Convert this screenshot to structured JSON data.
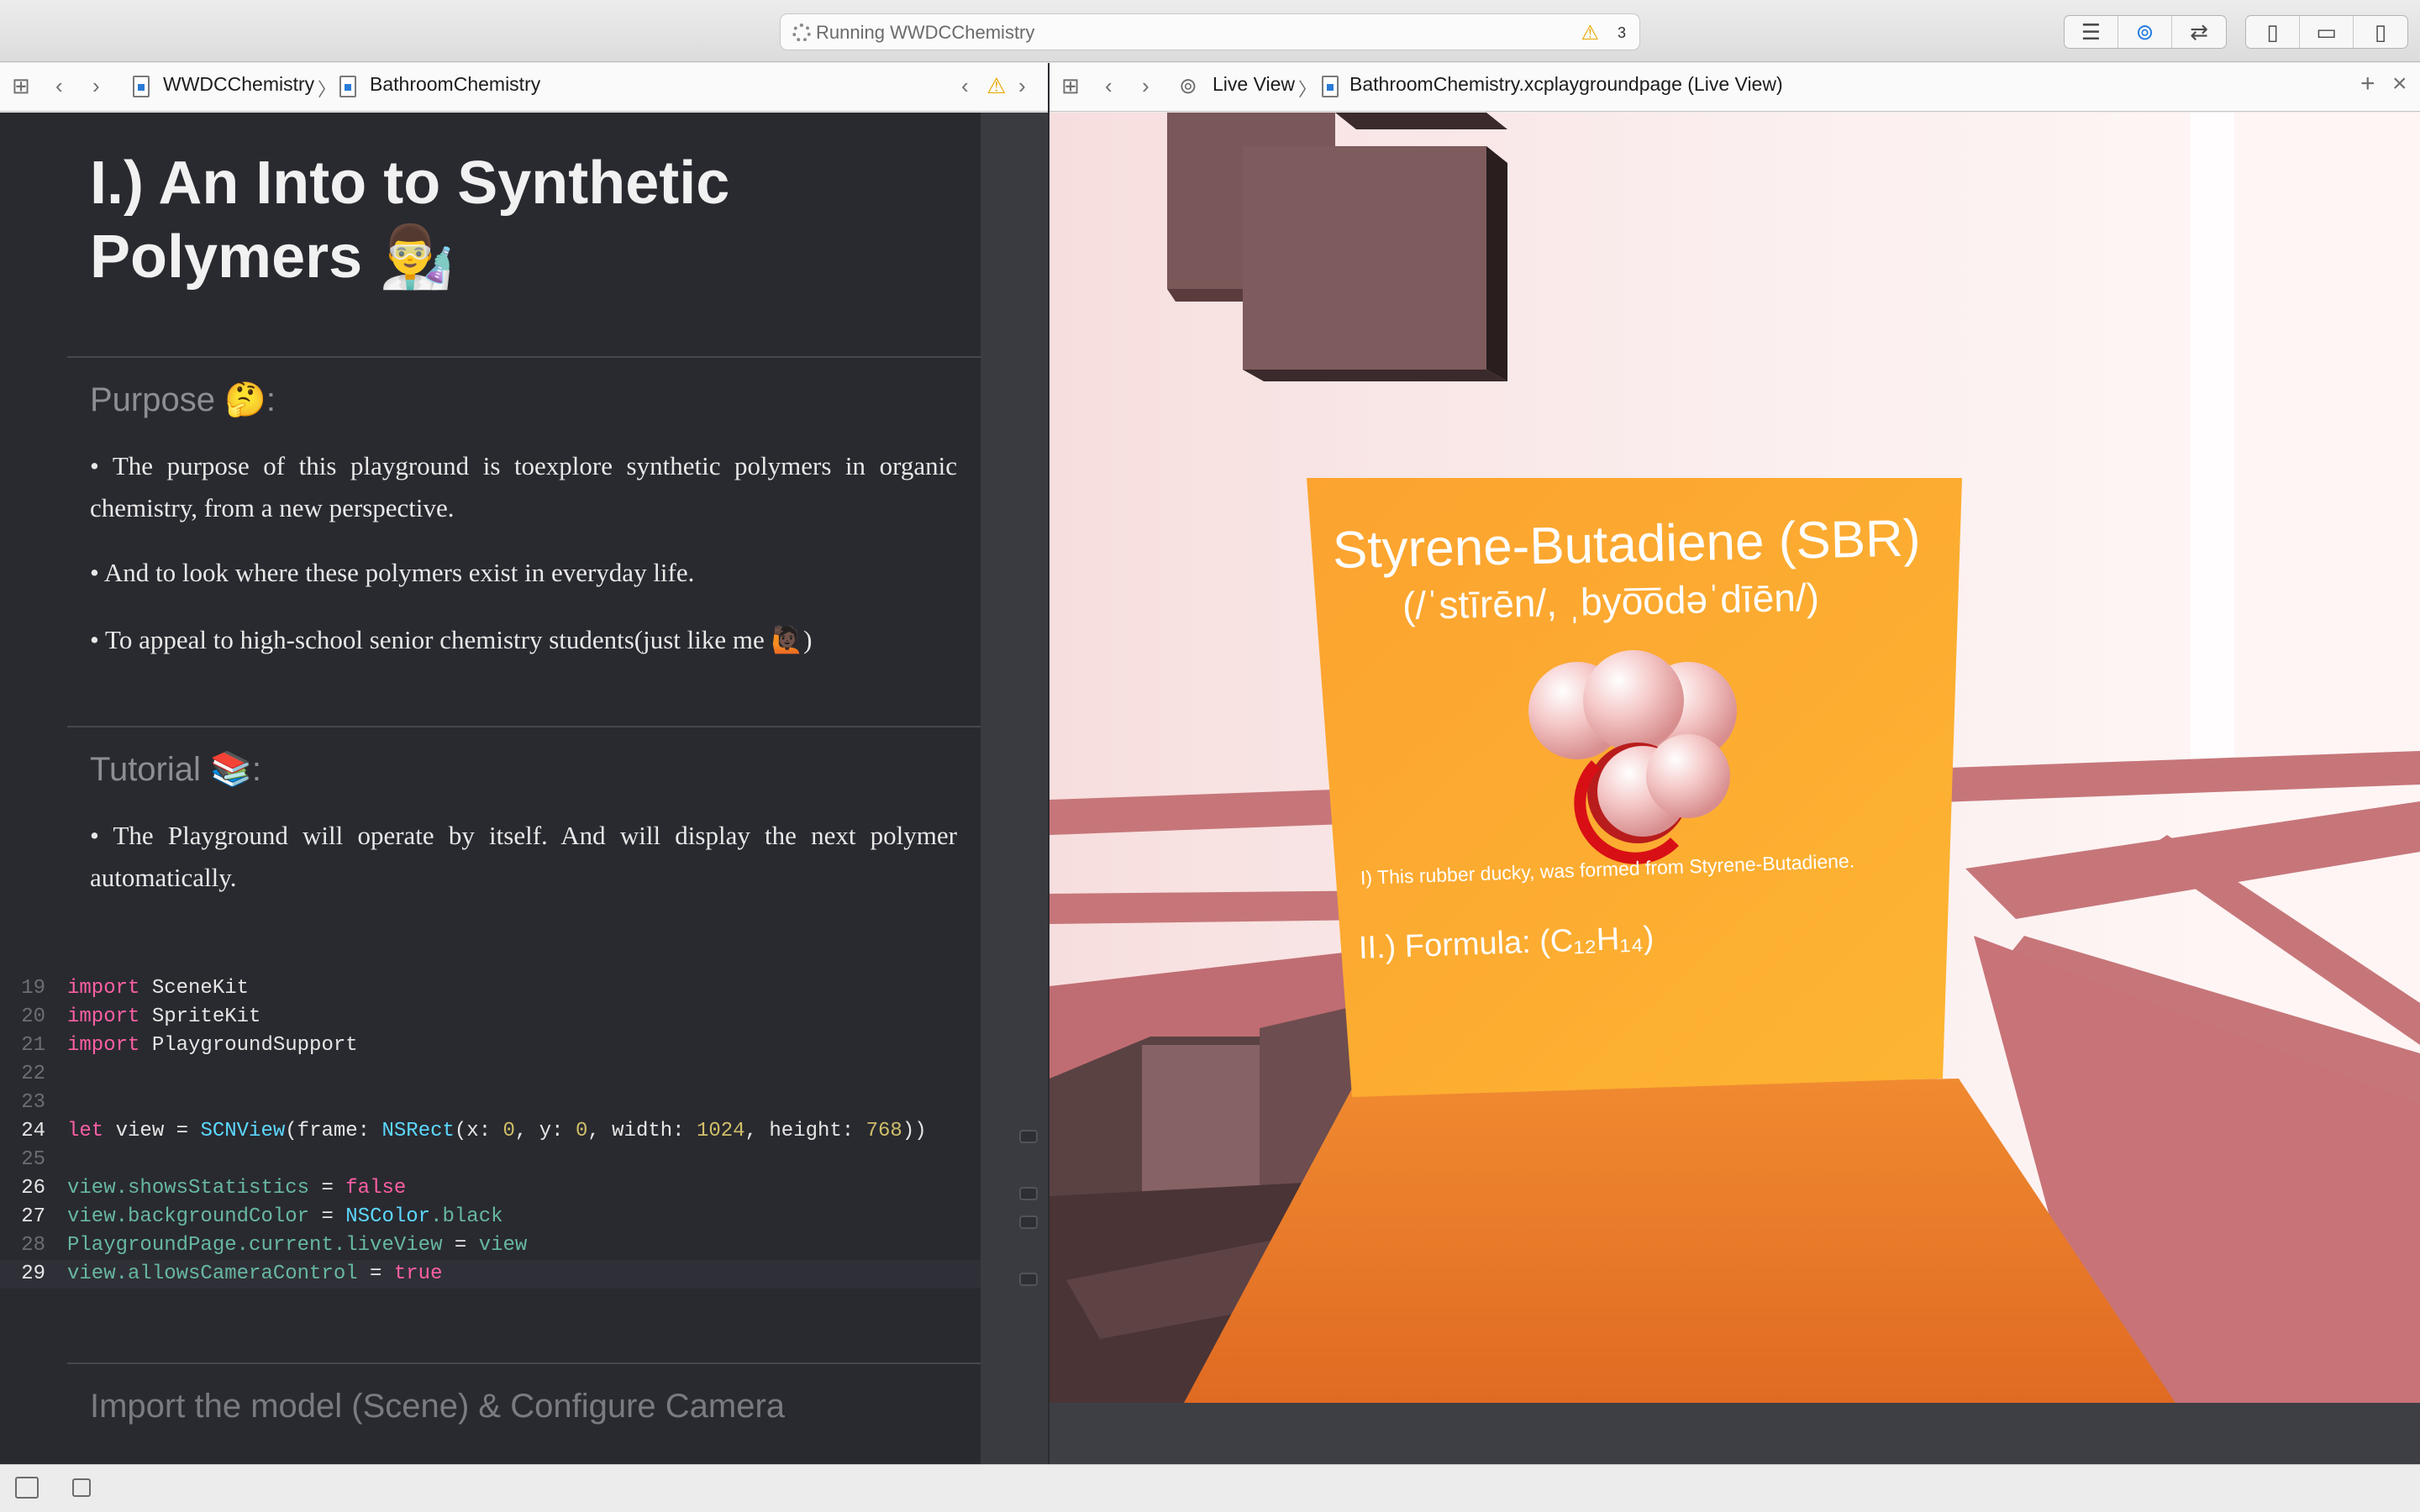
{
  "window": {
    "status": "Running WWDCChemistry",
    "warning_count": "3",
    "icons": [
      "spinner-icon",
      "warning-icon",
      "editor-standard-icon",
      "editor-assistant-icon",
      "editor-version-icon",
      "navigator-toggle-icon",
      "debug-area-toggle-icon",
      "utilities-toggle-icon"
    ]
  },
  "left_pathbar": {
    "project": "WWDCChemistry",
    "page": "BathroomChemistry"
  },
  "right_pathbar": {
    "mode": "Live View",
    "file": "BathroomChemistry.xcplaygroundpage (Live View)"
  },
  "doc": {
    "title": "I.) An Into to Synthetic Polymers 👨‍🔬",
    "purpose_heading": "Purpose 🤔:",
    "purpose_points": [
      "• The purpose of this playground is toexplore synthetic polymers in organic chemistry, from a new perspective.",
      "• And to look where these polymers exist in everyday life.",
      "• To appeal to high-school senior chemistry students(just like me 🙋🏿)"
    ],
    "tutorial_heading": "Tutorial 📚:",
    "tutorial_points": [
      "• The Playground will operate by itself. And will display the next polymer automatically."
    ],
    "next_heading": "Import the model (Scene) & Configure Camera"
  },
  "code": [
    {
      "n": "19",
      "tokens": [
        [
          "kw",
          "import"
        ],
        [
          "op",
          " SceneKit"
        ]
      ]
    },
    {
      "n": "20",
      "tokens": [
        [
          "kw",
          "import"
        ],
        [
          "op",
          " SpriteKit"
        ]
      ]
    },
    {
      "n": "21",
      "tokens": [
        [
          "kw",
          "import"
        ],
        [
          "op",
          " PlaygroundSupport"
        ]
      ]
    },
    {
      "n": "22",
      "tokens": []
    },
    {
      "n": "23",
      "tokens": []
    },
    {
      "n": "24",
      "tokens": [
        [
          "kw",
          "let"
        ],
        [
          "op",
          " view = "
        ],
        [
          "ty",
          "SCNView"
        ],
        [
          "op",
          "(frame: "
        ],
        [
          "ty",
          "NSRect"
        ],
        [
          "op",
          "(x: "
        ],
        [
          "num",
          "0"
        ],
        [
          "op",
          ", y: "
        ],
        [
          "num",
          "0"
        ],
        [
          "op",
          ", width: "
        ],
        [
          "num",
          "1024"
        ],
        [
          "op",
          ", height: "
        ],
        [
          "num",
          "768"
        ],
        [
          "op",
          "))"
        ]
      ]
    },
    {
      "n": "25",
      "tokens": []
    },
    {
      "n": "26",
      "tokens": [
        [
          "pr",
          "view.showsStatistics"
        ],
        [
          "op",
          " = "
        ],
        [
          "kw",
          "false"
        ]
      ]
    },
    {
      "n": "27",
      "tokens": [
        [
          "pr",
          "view.backgroundColor"
        ],
        [
          "op",
          " = "
        ],
        [
          "ty",
          "NSColor"
        ],
        [
          "pr",
          ".black"
        ]
      ]
    },
    {
      "n": "28",
      "tokens": [
        [
          "pr",
          "PlaygroundPage.current.liveView"
        ],
        [
          "op",
          " = "
        ],
        [
          "pr",
          "view"
        ]
      ]
    },
    {
      "n": "29",
      "tokens": [
        [
          "pr",
          "view.allowsCameraControl"
        ],
        [
          "op",
          " = "
        ],
        [
          "kw",
          "true"
        ]
      ]
    }
  ],
  "live_view": {
    "sign_title": "Styrene-Butadiene (SBR)",
    "sign_pronunciation": "(/ˈstīrēn/, ˌbyo͞odəˈdīēn/)",
    "sign_caption": "I) This rubber ducky, was formed from Styrene-Butadiene.",
    "sign_formula": "II.) Formula: (C₁₂H₁₄)",
    "colors": {
      "sign": "#fca832",
      "floor": "#ea7a2a",
      "wall": "#f9e6e6",
      "stripe": "#c67679",
      "block": "#7c5b5d"
    }
  }
}
